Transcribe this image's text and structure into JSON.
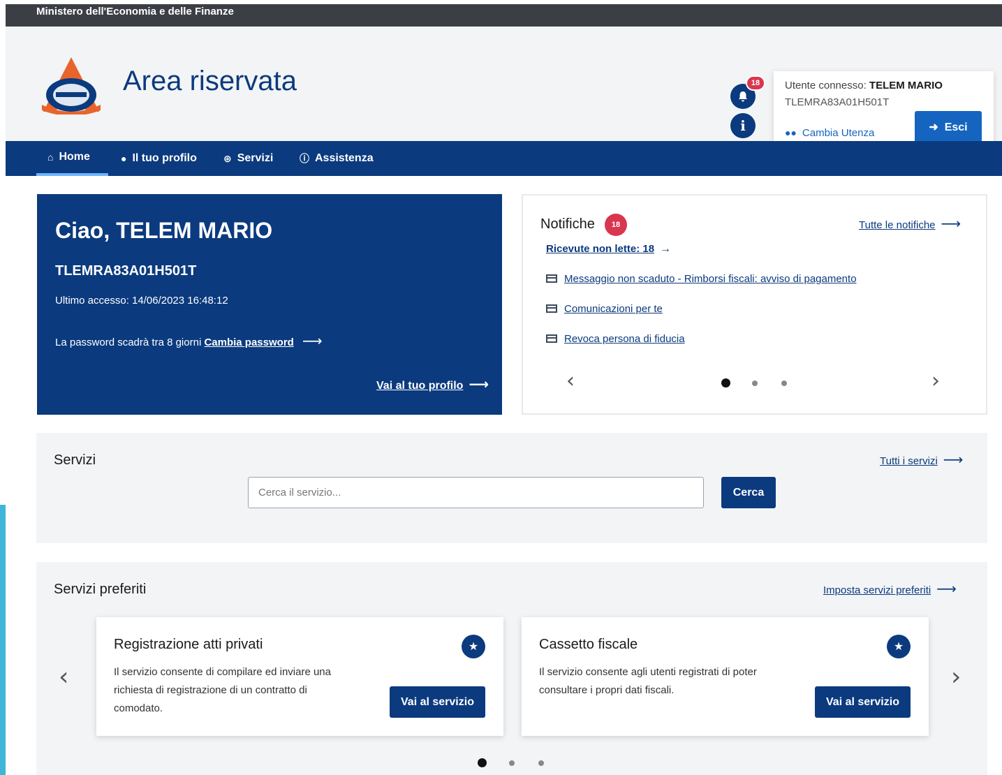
{
  "topbar": {
    "ministry": "Ministero dell'Economia e delle Finanze"
  },
  "header": {
    "title": "Area riservata",
    "notifications_count": "18",
    "info_icon": "i",
    "user": {
      "connected_label": "Utente connesso:",
      "name": "TELEM MARIO",
      "fiscal_code": "TLEMRA83A01H501T",
      "switch_label": "Cambia Utenza",
      "logout_label": "Esci"
    }
  },
  "nav": {
    "items": [
      {
        "label": "Home",
        "icon": "home-icon",
        "active": true
      },
      {
        "label": "Il tuo profilo",
        "icon": "user-icon"
      },
      {
        "label": "Servizi",
        "icon": "services-icon"
      },
      {
        "label": "Assistenza",
        "icon": "info-icon"
      }
    ]
  },
  "welcome": {
    "greeting": "Ciao, TELEM MARIO",
    "fiscal_code": "TLEMRA83A01H501T",
    "last_access": "Ultimo accesso: 14/06/2023 16:48:12",
    "password_text": "La password scadrà tra 8 giorni",
    "password_link": "Cambia password",
    "profile_link": "Vai al tuo profilo"
  },
  "notifications": {
    "title": "Notifiche",
    "badge": "18",
    "all_link": "Tutte le notifiche",
    "unread_link": "Ricevute non lette: 18",
    "messages": [
      "Messaggio non scaduto - Rimborsi fiscali: avviso di pagamento",
      "Comunicazioni per te",
      "Revoca persona di fiducia"
    ],
    "active_page": 1,
    "pages": 3
  },
  "services": {
    "title": "Servizi",
    "all_link": "Tutti i servizi",
    "search_placeholder": "Cerca il servizio...",
    "search_button": "Cerca"
  },
  "favorites": {
    "title": "Servizi preferiti",
    "set_link": "Imposta servizi preferiti",
    "cards": [
      {
        "title": "Registrazione atti privati",
        "description": "Il servizio consente di compilare ed inviare una richiesta di registrazione di un contratto di comodato.",
        "button": "Vai al servizio"
      },
      {
        "title": "Cassetto fiscale",
        "description": "Il servizio consente agli utenti registrati di poter consultare i propri dati fiscali.",
        "button": "Vai al servizio"
      }
    ],
    "active_page": 1,
    "pages": 3
  },
  "colors": {
    "primary": "#0b3a7e",
    "accent": "#1565c0",
    "badge": "#d9364f",
    "topbar": "#3b3f45"
  }
}
